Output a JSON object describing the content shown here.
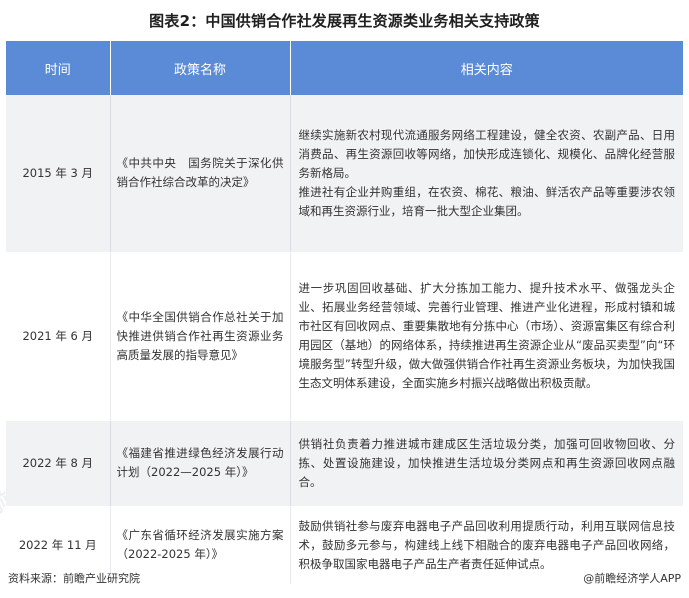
{
  "title": "图表2：中国供销合作社发展再生资源类业务相关支持政策",
  "table": {
    "headers": [
      "时间",
      "政策名称",
      "相关内容"
    ],
    "rows": [
      {
        "time": "2015 年 3 月",
        "policy": "《中共中央　国务院关于深化供销合作社综合改革的决定》",
        "content": [
          "继续实施新农村现代流通服务网络工程建设，健全农资、农副产品、日用消费品、再生资源回收等网络，加快形成连锁化、规模化、品牌化经营服务新格局。",
          "推进社有企业并购重组，在农资、棉花、粮油、鲜活农产品等重要涉农领域和再生资源行业，培育一批大型企业集团。"
        ]
      },
      {
        "time": "2021 年 6 月",
        "policy": "《中华全国供销合作总社关于加快推进供销合作社再生资源业务高质量发展的指导意见》",
        "content": [
          "进一步巩固回收基础、扩大分拣加工能力、提升技术水平、做强龙头企业、拓展业务经营领域、完善行业管理、推进产业化进程，形成村镇和城市社区有回收网点、重要集散地有分拣中心（市场）、资源富集区有综合利用园区（基地）的网络体系，持续推进再生资源企业从“废品买卖型”向“环境服务型”转型升级，做大做强供销合作社再生资源业务板块，为加快我国生态文明体系建设，全面实施乡村振兴战略做出积极贡献。"
        ]
      },
      {
        "time": "2022 年 8 月",
        "policy": "《福建省推进绿色经济发展行动计划（2022—2025 年）》",
        "content": [
          "供销社负责着力推进城市建成区生活垃圾分类，加强可回收物回收、分拣、处置设施建设，加快推进生活垃圾分类网点和再生资源回收网点融合。"
        ]
      },
      {
        "time": "2022 年 11 月",
        "policy": "《广东省循环经济发展实施方案（2022-2025 年）》",
        "content": [
          "鼓励供销社参与废弃电器电子产品回收利用提质行动，利用互联网信息技术，鼓励多元参与，构建线上线下相融合的废弃电器电子产品回收网络，积极争取国家电器电子产品生产者责任延伸试点。"
        ]
      }
    ]
  },
  "footer": {
    "source": "资料来源：前瞻产业研究院",
    "brand": "@前瞻经济学人APP"
  },
  "watermark": "前瞻产业研究院",
  "colors": {
    "header_bg": "#5b8bd6",
    "stripe_bg": "#f1f2f4"
  }
}
